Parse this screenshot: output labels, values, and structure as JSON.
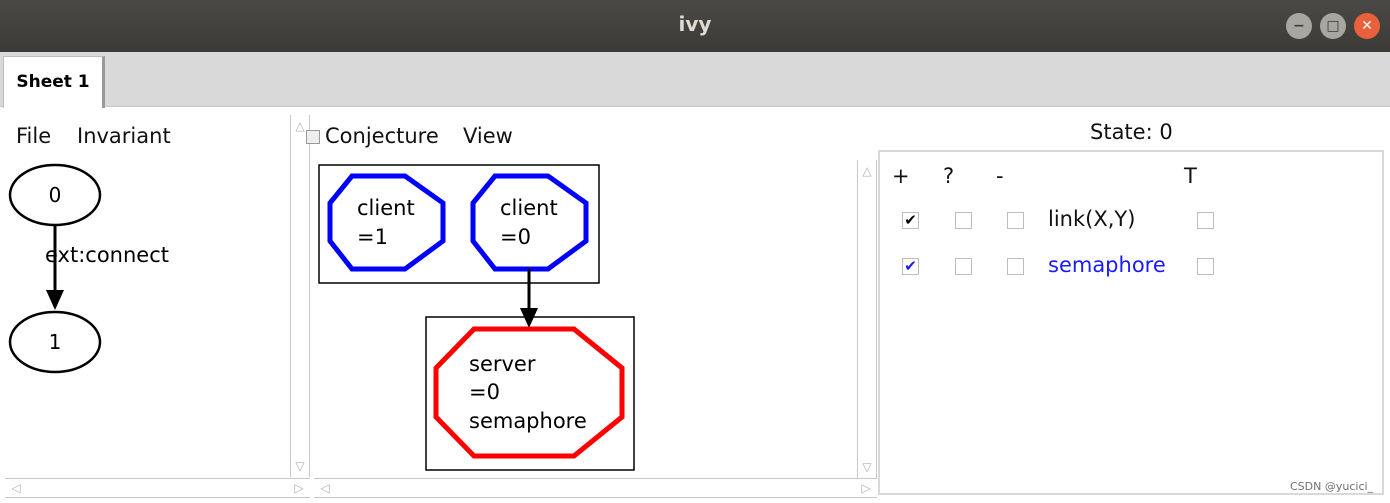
{
  "window": {
    "title": "ivy",
    "controls": {
      "minimize": "−",
      "maximize": "□",
      "close": "✕"
    }
  },
  "tabs": [
    {
      "label": "Sheet 1"
    }
  ],
  "left_panel": {
    "menu": [
      "File",
      "Invariant"
    ],
    "graph": {
      "nodes": [
        "0",
        "1"
      ],
      "edge_label": "ext:connect"
    }
  },
  "center_panel": {
    "menu": [
      "Conjecture",
      "View"
    ],
    "nodes": [
      {
        "line1": "client",
        "line2": "=1",
        "color": "#0000ff"
      },
      {
        "line1": "client",
        "line2": "=0",
        "color": "#0000ff"
      },
      {
        "line1": "server",
        "line2": "=0",
        "line3": "semaphore",
        "color": "#ff0000"
      }
    ]
  },
  "right_panel": {
    "state_label": "State: 0",
    "columns": [
      "+",
      "?",
      "-",
      "T"
    ],
    "rows": [
      {
        "label": "link(X,Y)",
        "plus_checked": true,
        "q_checked": false,
        "minus_checked": false,
        "t_checked": false,
        "color": "#111111"
      },
      {
        "label": "semaphore",
        "plus_checked": true,
        "q_checked": false,
        "minus_checked": false,
        "t_checked": false,
        "color": "#1a1aff"
      }
    ],
    "check_glyph": "✔"
  },
  "watermark": "CSDN @yucici_"
}
